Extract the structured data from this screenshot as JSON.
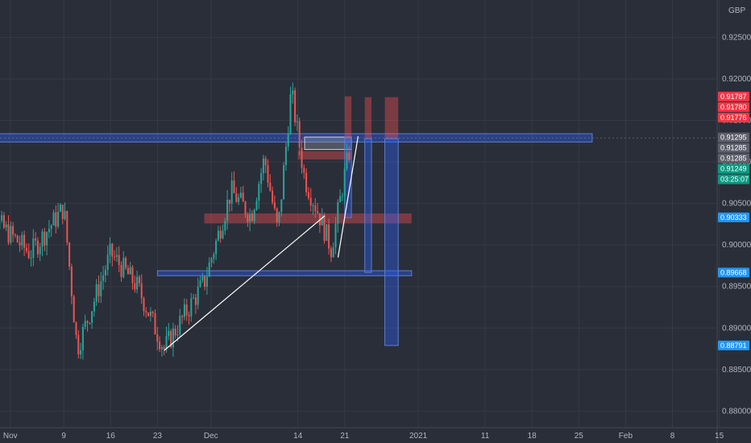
{
  "currency_label": "GBP",
  "chart_data": {
    "type": "candlestick",
    "colors": {
      "background": "#2a2e39",
      "grid": "#363a45",
      "axis_text": "#b2b5be",
      "up_candle": "#26a69a",
      "down_candle": "#ef5350",
      "zone_blue": "#2962ff",
      "zone_red": "#ff5252",
      "trendline": "#ffffff",
      "tag_red": "#f23645",
      "tag_grey": "#5d606b",
      "tag_green": "#089981",
      "tag_blue": "#2196f3"
    },
    "y_axis": {
      "range": [
        0.878,
        0.9295
      ],
      "ticks": [
        "0.92500",
        "0.92000",
        "0.91500",
        "0.91000",
        "0.90500",
        "0.90000",
        "0.89500",
        "0.89000",
        "0.88500",
        "0.88000"
      ],
      "tick_values": [
        0.925,
        0.92,
        0.915,
        0.91,
        0.905,
        0.9,
        0.895,
        0.89,
        0.885,
        0.88
      ]
    },
    "x_axis": {
      "labels": [
        "Nov",
        "9",
        "16",
        "23",
        "Dec",
        "14",
        "21",
        "2021",
        "11",
        "18",
        "25",
        "Feb",
        "8",
        "15"
      ],
      "label_dates": [
        "2020-11-01",
        "2020-11-09",
        "2020-11-16",
        "2020-11-23",
        "2020-12-01",
        "2020-12-14",
        "2020-12-21",
        "2021-01-01",
        "2021-01-11",
        "2021-01-18",
        "2021-01-25",
        "2021-02-01",
        "2021-02-08",
        "2021-02-15"
      ]
    },
    "price_tags": [
      {
        "text": "0.91787",
        "value": 0.91787,
        "color": "red"
      },
      {
        "text": "0.91780",
        "value": 0.9178,
        "color": "red"
      },
      {
        "text": "0.91776",
        "value": 0.91776,
        "color": "red"
      },
      {
        "text": "0.91295",
        "value": 0.91295,
        "color": "grey"
      },
      {
        "text": "0.91285",
        "value": 0.91285,
        "color": "grey"
      },
      {
        "text": "0.91285",
        "value": 0.91285,
        "color": "grey"
      },
      {
        "text": "0.91249",
        "value": 0.91249,
        "color": "green"
      },
      {
        "text": "03:25:07",
        "value": 0.91249,
        "color": "green"
      },
      {
        "text": "0.90333",
        "value": 0.90333,
        "color": "blue"
      },
      {
        "text": "0.89668",
        "value": 0.89668,
        "color": "blue"
      },
      {
        "text": "0.88791",
        "value": 0.88791,
        "color": "blue"
      }
    ],
    "zones": [
      {
        "kind": "blue",
        "x0": "2020-10-27",
        "x1": "2021-01-27",
        "y0": 0.9124,
        "y1": 0.9134
      },
      {
        "kind": "blue",
        "x0": "2020-11-23",
        "x1": "2020-12-31",
        "y0": 0.8963,
        "y1": 0.8969
      },
      {
        "kind": "red",
        "x0": "2020-11-30",
        "x1": "2020-12-31",
        "y0": 0.9026,
        "y1": 0.9038
      },
      {
        "kind": "red",
        "x0": "2020-12-14",
        "x1": "2020-12-22",
        "y0": 0.9103,
        "y1": 0.9113
      },
      {
        "kind": "grey",
        "x0": "2020-12-15",
        "x1": "2020-12-22",
        "y0": 0.9115,
        "y1": 0.913
      },
      {
        "kind": "blue",
        "x0": "2020-12-21",
        "x1": "2020-12-22",
        "y0": 0.9033,
        "y1": 0.913
      },
      {
        "kind": "red",
        "x0": "2020-12-21",
        "x1": "2020-12-22",
        "y0": 0.9128,
        "y1": 0.9179
      },
      {
        "kind": "blue",
        "x0": "2020-12-24",
        "x1": "2020-12-25",
        "y0": 0.8967,
        "y1": 0.9128
      },
      {
        "kind": "red",
        "x0": "2020-12-24",
        "x1": "2020-12-25",
        "y0": 0.9128,
        "y1": 0.9178
      },
      {
        "kind": "blue",
        "x0": "2020-12-27",
        "x1": "2020-12-29",
        "y0": 0.8879,
        "y1": 0.9128
      },
      {
        "kind": "red",
        "x0": "2020-12-27",
        "x1": "2020-12-29",
        "y0": 0.9128,
        "y1": 0.9178
      }
    ],
    "trendlines": [
      {
        "x0": "2020-11-24",
        "y0": 0.8873,
        "x1": "2020-12-18",
        "y1": 0.9035
      },
      {
        "x0": "2020-12-20",
        "y0": 0.8985,
        "x1": "2020-12-23",
        "y1": 0.9131
      }
    ],
    "crosshair_value": 0.9129,
    "series_close": [
      {
        "date": "2020-10-27",
        "close": 0.905
      },
      {
        "date": "2020-11-04",
        "close": 0.899
      },
      {
        "date": "2020-11-09",
        "close": 0.9045
      },
      {
        "date": "2020-11-11",
        "close": 0.8875
      },
      {
        "date": "2020-11-16",
        "close": 0.899
      },
      {
        "date": "2020-11-20",
        "close": 0.895
      },
      {
        "date": "2020-11-24",
        "close": 0.8875
      },
      {
        "date": "2020-11-30",
        "close": 0.8955
      },
      {
        "date": "2020-12-04",
        "close": 0.9065
      },
      {
        "date": "2020-12-07",
        "close": 0.9035
      },
      {
        "date": "2020-12-09",
        "close": 0.9105
      },
      {
        "date": "2020-12-11",
        "close": 0.9015
      },
      {
        "date": "2020-12-13",
        "close": 0.9185
      },
      {
        "date": "2020-12-15",
        "close": 0.908
      },
      {
        "date": "2020-12-17",
        "close": 0.904
      },
      {
        "date": "2020-12-19",
        "close": 0.8995
      },
      {
        "date": "2020-12-21",
        "close": 0.9085
      },
      {
        "date": "2020-12-22",
        "close": 0.9125
      }
    ]
  }
}
